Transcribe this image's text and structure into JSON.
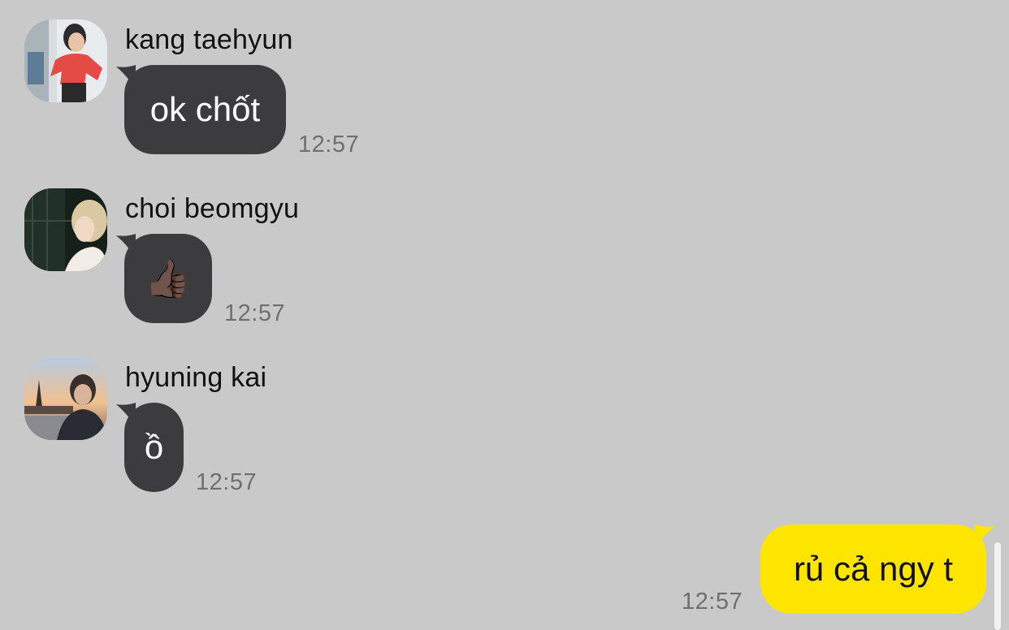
{
  "messages": [
    {
      "sender": "kang taehyun",
      "text": "ok chốt",
      "time": "12:57",
      "avatar_icon": "avatar-kang-taehyun"
    },
    {
      "sender": "choi beomgyu",
      "text": "👍🏿",
      "time": "12:57",
      "avatar_icon": "avatar-choi-beomgyu"
    },
    {
      "sender": "hyuning kai",
      "text": "ồ",
      "time": "12:57",
      "avatar_icon": "avatar-hyuning-kai"
    }
  ],
  "my_message": {
    "text": "rủ cả ngy t",
    "time": "12:57"
  },
  "colors": {
    "background": "#c9c9c9",
    "incoming_bubble": "#3c3c3e",
    "outgoing_bubble": "#fee500",
    "timestamp": "#6f6f6f"
  }
}
